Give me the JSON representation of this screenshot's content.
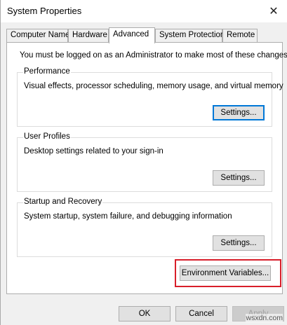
{
  "window": {
    "title": "System Properties",
    "close_glyph": "✕"
  },
  "tabs": [
    {
      "label": "Computer Name"
    },
    {
      "label": "Hardware"
    },
    {
      "label": "Advanced"
    },
    {
      "label": "System Protection"
    },
    {
      "label": "Remote"
    }
  ],
  "active_tab": "Advanced",
  "notice": "You must be logged on as an Administrator to make most of these changes.",
  "groups": {
    "performance": {
      "label": "Performance",
      "description": "Visual effects, processor scheduling, memory usage, and virtual memory",
      "button": "Settings..."
    },
    "user_profiles": {
      "label": "User Profiles",
      "description": "Desktop settings related to your sign-in",
      "button": "Settings..."
    },
    "startup_recovery": {
      "label": "Startup and Recovery",
      "description": "System startup, system failure, and debugging information",
      "button": "Settings..."
    }
  },
  "environment_button": "Environment Variables...",
  "footer": {
    "ok": "OK",
    "cancel": "Cancel",
    "apply": "Apply"
  },
  "watermark": "wsxdn.com",
  "colors": {
    "highlight": "#d81e2a",
    "focus": "#0078d7"
  }
}
